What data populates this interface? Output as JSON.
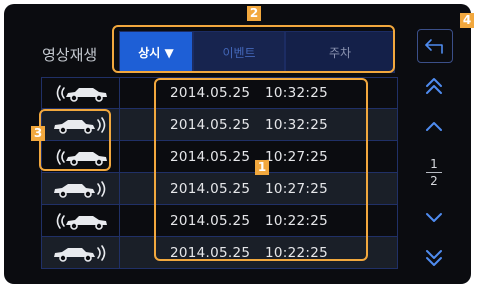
{
  "screen": {
    "title": "영상재생"
  },
  "tabs": [
    {
      "label": "상시 ▼"
    },
    {
      "label": "이벤트"
    },
    {
      "label": "주차"
    }
  ],
  "rows": [
    {
      "icon": "car-signal-front-icon",
      "date": "2014.05.25",
      "time": "10:32:25"
    },
    {
      "icon": "car-signal-rear-icon",
      "date": "2014.05.25",
      "time": "10:32:25"
    },
    {
      "icon": "car-signal-front-icon",
      "date": "2014.05.25",
      "time": "10:27:25"
    },
    {
      "icon": "car-signal-rear-icon",
      "date": "2014.05.25",
      "time": "10:27:25"
    },
    {
      "icon": "car-signal-front-icon",
      "date": "2014.05.25",
      "time": "10:22:25"
    },
    {
      "icon": "car-signal-rear-icon",
      "date": "2014.05.25",
      "time": "10:22:25"
    }
  ],
  "pagination": {
    "current": "1",
    "total": "2"
  },
  "callouts": {
    "c1": "1",
    "c2": "2",
    "c3": "3",
    "c4": "4"
  },
  "colors": {
    "accent": "#1e5fd6",
    "callout": "#f2a83e",
    "background": "#0b0c10"
  }
}
